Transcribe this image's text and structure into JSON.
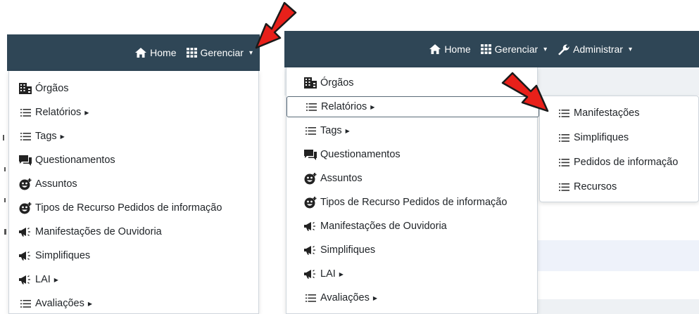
{
  "nav": {
    "home": "Home",
    "gerenciar": "Gerenciar",
    "administrar": "Administrar"
  },
  "icons": {
    "home": "home-icon",
    "grid": "grid-icon",
    "wrench": "wrench-icon",
    "list": "list-icon",
    "building": "building-icon",
    "chat": "chat-icon",
    "face": "face-icon",
    "megaphone": "megaphone-icon",
    "arrow": "red-arrow-icon"
  },
  "colors": {
    "navbar": "#2f4656",
    "arrow": "#e8201a"
  },
  "menu_left": {
    "items": [
      {
        "label": "Órgãos",
        "icon": "building-icon",
        "sub": false
      },
      {
        "label": "Relatórios",
        "icon": "list-icon",
        "sub": true
      },
      {
        "label": "Tags",
        "icon": "list-icon",
        "sub": true
      },
      {
        "label": "Questionamentos",
        "icon": "chat-icon",
        "sub": false
      },
      {
        "label": "Assuntos",
        "icon": "face-icon",
        "sub": false
      },
      {
        "label": "Tipos de Recurso Pedidos de informação",
        "icon": "face-icon",
        "sub": false
      },
      {
        "label": "Manifestações de Ouvidoria",
        "icon": "megaphone-icon",
        "sub": false
      },
      {
        "label": "Simplifiques",
        "icon": "megaphone-icon",
        "sub": false
      },
      {
        "label": "LAI",
        "icon": "megaphone-icon",
        "sub": true
      },
      {
        "label": "Avaliações",
        "icon": "list-icon",
        "sub": true
      }
    ]
  },
  "menu_right": {
    "items": [
      {
        "label": "Órgãos",
        "icon": "building-icon",
        "sub": false
      },
      {
        "label": "Relatórios",
        "icon": "list-icon",
        "sub": true
      },
      {
        "label": "Tags",
        "icon": "list-icon",
        "sub": true
      },
      {
        "label": "Questionamentos",
        "icon": "chat-icon",
        "sub": false
      },
      {
        "label": "Assuntos",
        "icon": "face-icon",
        "sub": false
      },
      {
        "label": "Tipos de Recurso Pedidos de informação",
        "icon": "face-icon",
        "sub": false
      },
      {
        "label": "Manifestações de Ouvidoria",
        "icon": "megaphone-icon",
        "sub": false
      },
      {
        "label": "Simplifiques",
        "icon": "megaphone-icon",
        "sub": false
      },
      {
        "label": "LAI",
        "icon": "megaphone-icon",
        "sub": true
      },
      {
        "label": "Avaliações",
        "icon": "list-icon",
        "sub": true
      }
    ]
  },
  "submenu": {
    "items": [
      {
        "label": "Manifestações",
        "icon": "list-icon"
      },
      {
        "label": "Simplifiques",
        "icon": "list-icon"
      },
      {
        "label": "Pedidos de informação",
        "icon": "list-icon"
      },
      {
        "label": "Recursos",
        "icon": "list-icon"
      }
    ]
  }
}
